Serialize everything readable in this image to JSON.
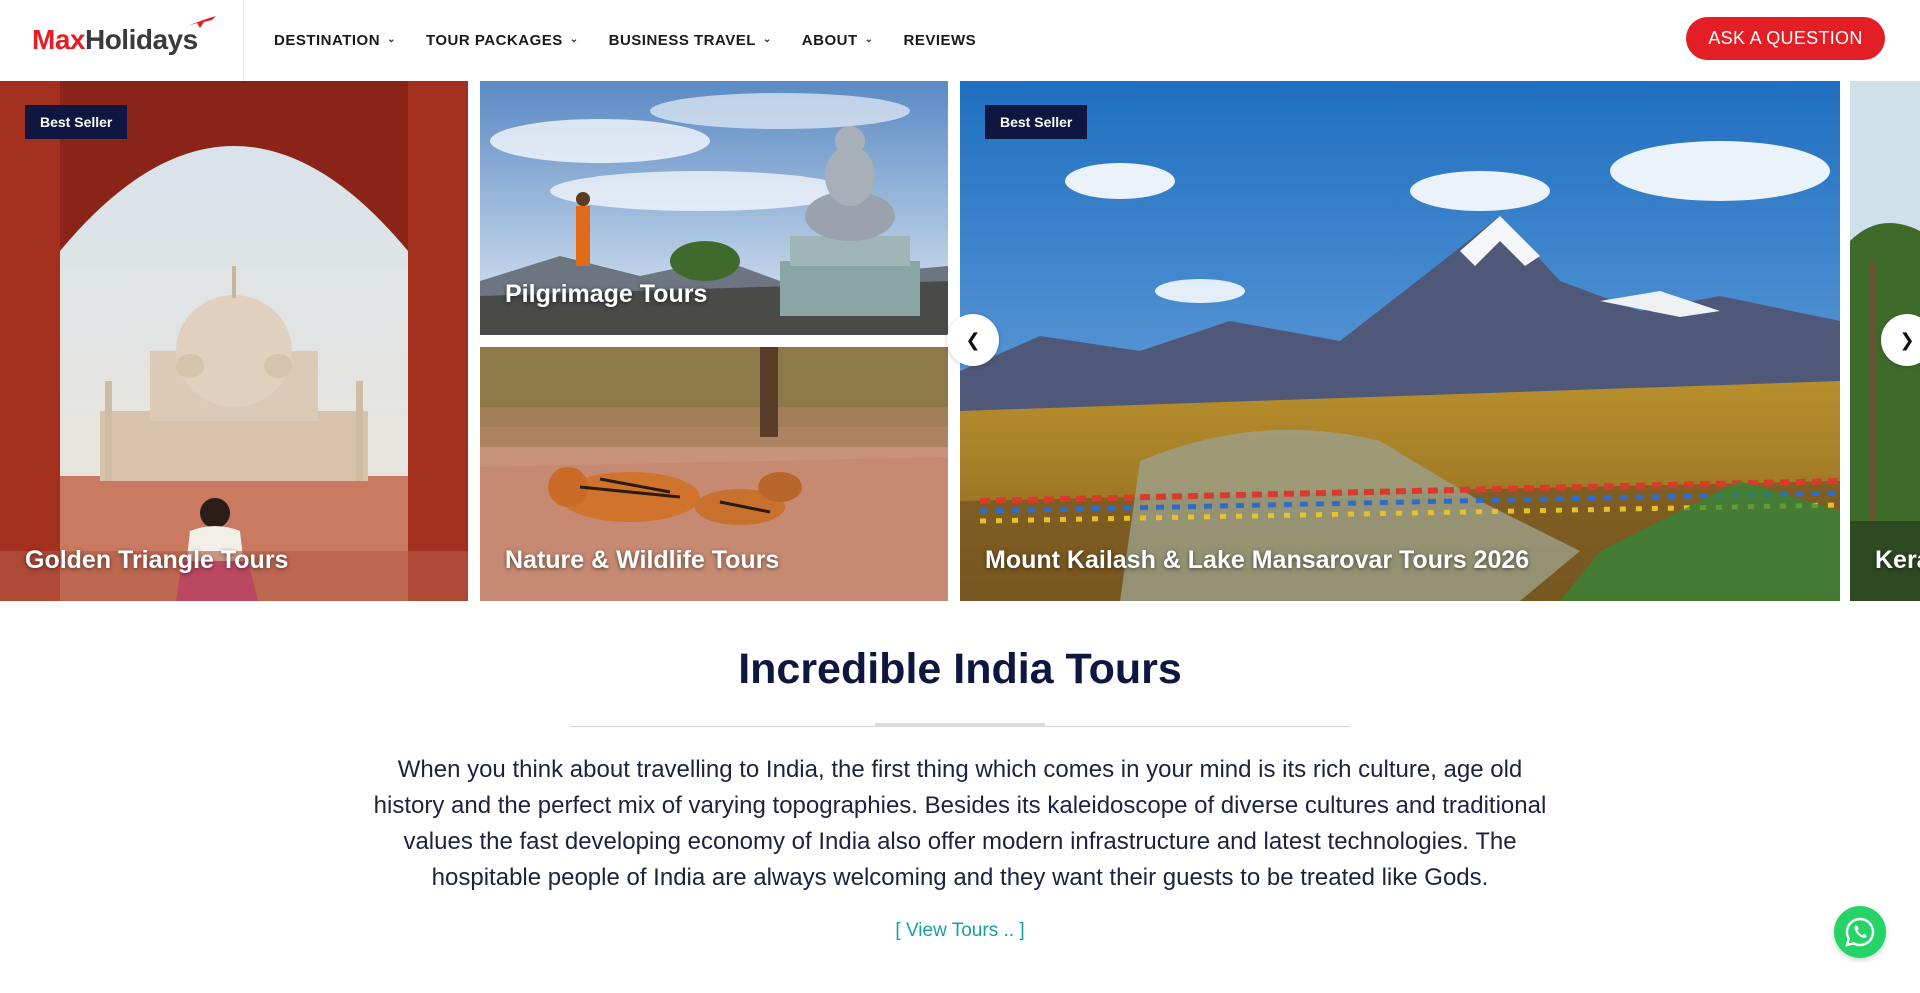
{
  "brand": {
    "name_part1": "Max",
    "name_part2": "Holidays",
    "red": "#e31e24",
    "dark": "#3a3a3a",
    "navy": "#0f1740"
  },
  "nav": {
    "items": [
      {
        "label": "DESTINATION",
        "has_dropdown": true
      },
      {
        "label": "TOUR PACKAGES",
        "has_dropdown": true
      },
      {
        "label": "BUSINESS TRAVEL",
        "has_dropdown": true
      },
      {
        "label": "ABOUT",
        "has_dropdown": true
      },
      {
        "label": "REVIEWS",
        "has_dropdown": false
      }
    ],
    "cta_label": "ASK A QUESTION"
  },
  "carousel": {
    "prev_icon": "❮",
    "next_icon": "❯",
    "tiles": [
      {
        "title": "Golden Triangle Tours",
        "badge": "Best Seller",
        "image": "taj-mahal-through-arch"
      },
      {
        "title": "Pilgrimage Tours",
        "badge": "",
        "image": "monk-and-buddha-statue"
      },
      {
        "title": "Nature & Wildlife Tours",
        "badge": "",
        "image": "tigers-resting"
      },
      {
        "title": "Mount Kailash & Lake Mansarovar Tours 2026",
        "badge": "Best Seller",
        "image": "mount-kailash-prayer-flags"
      },
      {
        "title": "Kera",
        "badge": "",
        "image": "kerala-palms"
      }
    ]
  },
  "main": {
    "title": "Incredible India Tours",
    "intro": "When you think about travelling to India, the first thing which comes in your mind is its rich culture, age old history and the perfect mix of varying topographies. Besides its kaleidoscope of diverse cultures and traditional values the fast developing economy of India also offer modern infrastructure and latest technologies. The hospitable people of India are always welcoming and they want their guests to be treated like Gods.",
    "view_link": "[ View Tours .. ]"
  },
  "widgets": {
    "whatsapp_icon": "whatsapp-icon",
    "whatsapp_color": "#25d366"
  }
}
